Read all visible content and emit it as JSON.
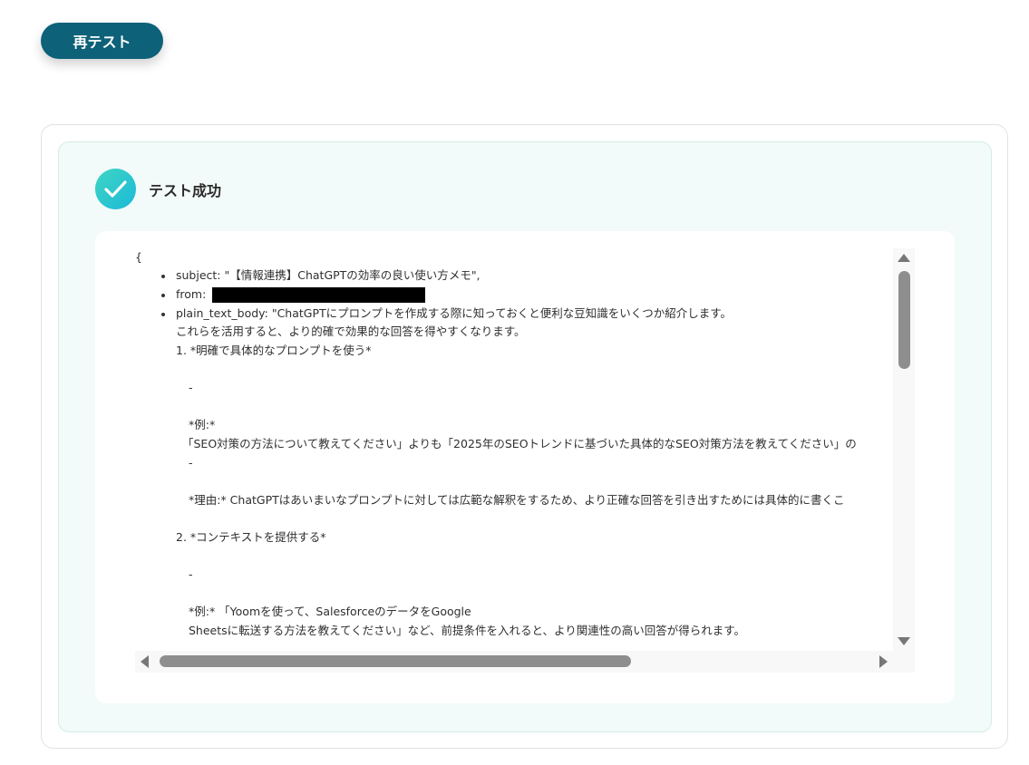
{
  "retest_button": {
    "label": "再テスト"
  },
  "result": {
    "title": "テスト成功",
    "code_lines": {
      "open_brace": "{",
      "subject": "subject: \"【情報連携】ChatGPTの効率の良い使い方メモ\",",
      "from": "from:",
      "plain_text_body": "plain_text_body: \"ChatGPTにプロンプトを作成する際に知っておくと便利な豆知識をいくつか紹介します。",
      "line_intro2": "これらを活用すると、より的確で効果的な回答を得やすくなります。",
      "item1_heading": "1. *明確で具体的なプロンプトを使う*",
      "dash1": "-",
      "example1_label": "*例:*",
      "example1_text": "「SEO対策の方法について教えてください」よりも「2025年のSEOトレンドに基づいた具体的なSEO対策方法を教えてください」の",
      "dash2": "-",
      "reason1": "*理由:* ChatGPTはあいまいなプロンプトに対しては広範な解釈をするため、より正確な回答を引き出すためには具体的に書くこ",
      "item2_heading": "2. *コンテキストを提供する*",
      "dash3": "-",
      "example2_line1": "*例:* 「Yoomを使って、SalesforceのデータをGoogle",
      "example2_line2": "Sheetsに転送する方法を教えてください」など、前提条件を入れると、より関連性の高い回答が得られます。"
    }
  },
  "colors": {
    "button_bg": "#0d6178",
    "panel_bg": "#f2fbf9",
    "success_gradient_start": "#3fd6c3",
    "success_gradient_end": "#1bb9d8"
  }
}
